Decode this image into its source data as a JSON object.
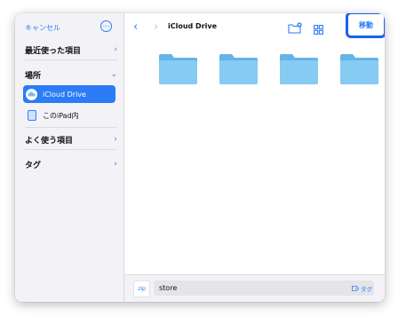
{
  "sidebar": {
    "cancel_label": "キャンセル",
    "more_icon": "ellipsis-circle-icon",
    "recents_label": "最近使った項目",
    "locations_label": "場所",
    "locations": [
      {
        "label": "iCloud Drive",
        "icon": "icloud-icon",
        "selected": true
      },
      {
        "label": "このiPad内",
        "icon": "ipad-icon",
        "selected": false
      }
    ],
    "favorites_label": "よく使う項目",
    "tags_label": "タグ"
  },
  "header": {
    "title": "iCloud Drive",
    "move_label": "移動"
  },
  "content": {
    "folder_count": 4
  },
  "bottom": {
    "file_icon_label": "zip",
    "filename_value": "store",
    "tag_label": "タグ"
  },
  "colors": {
    "accent": "#2b7cf6",
    "highlight_border": "#1a60f0",
    "folder": "#7fc6ef"
  }
}
